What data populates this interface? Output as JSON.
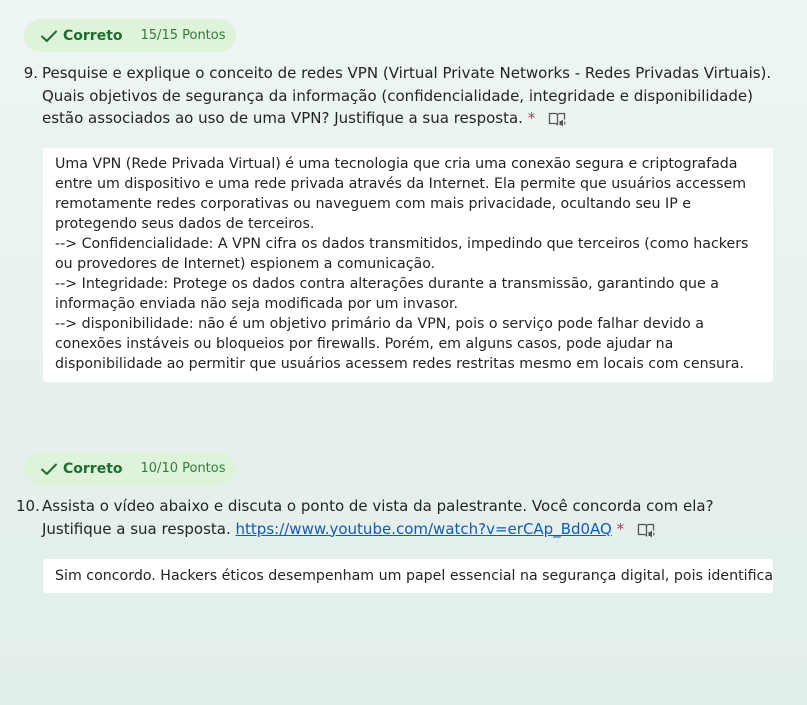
{
  "questions": [
    {
      "status": "Correto",
      "points": "15/15 Pontos",
      "number": "9.",
      "text_lines": [
        "Pesquise e explique o conceito de redes VPN (Virtual Private Networks - Redes Privadas Virtuais).",
        "Quais objetivos de segurança da informação (confidencialidade, integridade e disponibilidade)",
        "estão associados ao uso de uma VPN? Justifique a sua resposta."
      ],
      "required_mark": "*",
      "icon": "immersive-reader-icon",
      "answer_lines": [
        "Uma VPN (Rede Privada Virtual) é uma tecnologia que cria uma conexão segura e criptografada",
        "entre um dispositivo e uma rede privada através da Internet. Ela permite que usuários accessem",
        "remotamente redes corporativas ou naveguem com mais privacidade, ocultando seu IP e",
        "protegendo seus dados de terceiros.",
        "--> Confidencialidade: A VPN cifra os dados transmitidos, impedindo que terceiros (como hackers",
        "ou provedores de Internet) espionem a comunicação.",
        "--> Integridade: Protege os dados contra alterações durante a transmissão, garantindo que a",
        "informação enviada não seja modificada por um invasor.",
        "--> disponibilidade: não é um objetivo primário da VPN, pois o serviço pode falhar devido a",
        "conexões instáveis ou bloqueios por firewalls. Porém, em alguns casos, pode ajudar na",
        "disponibilidade ao permitir que usuários acessem redes restritas mesmo em locais com censura."
      ]
    },
    {
      "status": "Correto",
      "points": "10/10 Pontos",
      "number": "10.",
      "text_line1": "Assista o vídeo abaixo e discuta o ponto de vista da palestrante. Você concorda com ela?",
      "text_line2_prefix": "Justifique a sua resposta.",
      "link": "https://www.youtube.com/watch?v=erCAp_Bd0AQ",
      "required_mark": "*",
      "icon": "immersive-reader-icon",
      "answer_text": "Sim concordo. Hackers éticos desempenham um papel essencial na segurança digital, pois identifica"
    }
  ],
  "colors": {
    "badge_bg": "#dff3da",
    "badge_text": "#1b6e2e",
    "required": "#c4314b",
    "link": "#0f5bb5"
  }
}
